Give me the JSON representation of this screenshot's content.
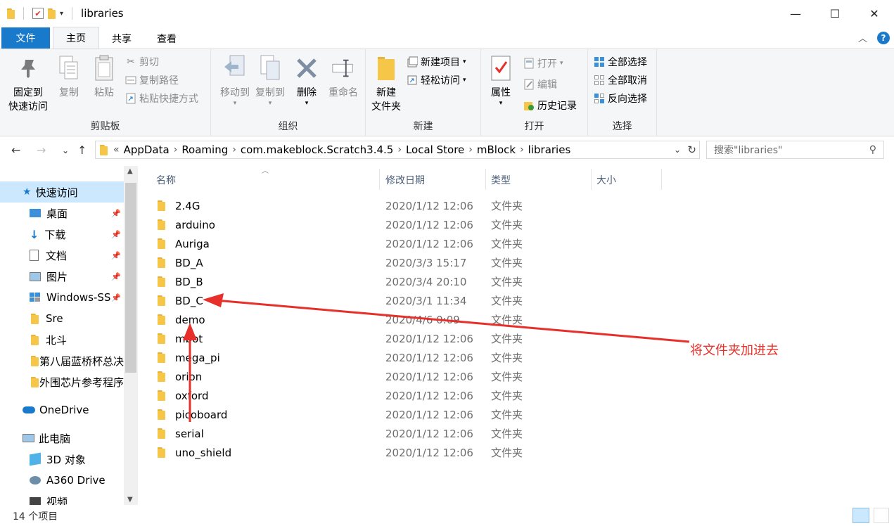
{
  "window": {
    "title": "libraries",
    "controls": {
      "minimize": "—",
      "maximize": "☐",
      "close": "✕"
    }
  },
  "tabs": [
    {
      "label": "文件"
    },
    {
      "label": "主页"
    },
    {
      "label": "共享"
    },
    {
      "label": "查看"
    }
  ],
  "ribbon": {
    "clipboard": {
      "label": "剪贴板",
      "pin_line1": "固定到",
      "pin_line2": "快速访问",
      "copy": "复制",
      "paste": "粘贴",
      "cut": "剪切",
      "copy_path": "复制路径",
      "paste_shortcut": "粘贴快捷方式"
    },
    "organize": {
      "label": "组织",
      "move_to": "移动到",
      "copy_to": "复制到",
      "delete": "删除",
      "rename": "重命名"
    },
    "new": {
      "label": "新建",
      "new_folder_line1": "新建",
      "new_folder_line2": "文件夹",
      "new_item": "新建项目",
      "easy_access": "轻松访问"
    },
    "open": {
      "label": "打开",
      "properties": "属性",
      "open": "打开",
      "edit": "编辑",
      "history": "历史记录"
    },
    "select": {
      "label": "选择",
      "select_all": "全部选择",
      "select_none": "全部取消",
      "invert": "反向选择"
    }
  },
  "address": {
    "prefix": "«",
    "crumbs": [
      "AppData",
      "Roaming",
      "com.makeblock.Scratch3.4.5",
      "Local Store",
      "mBlock",
      "libraries"
    ],
    "search_placeholder": "搜索\"libraries\""
  },
  "sidebar": {
    "quick_access": "快速访问",
    "items": [
      {
        "label": "桌面",
        "pinned": true
      },
      {
        "label": "下载",
        "pinned": true
      },
      {
        "label": "文档",
        "pinned": true
      },
      {
        "label": "图片",
        "pinned": true
      },
      {
        "label": "Windows-SS",
        "pinned": true
      },
      {
        "label": "Sre",
        "pinned": false
      },
      {
        "label": "北斗",
        "pinned": false
      },
      {
        "label": "第八届蓝桥杯总决",
        "pinned": false
      },
      {
        "label": "外围芯片参考程序",
        "pinned": false
      }
    ],
    "onedrive": "OneDrive",
    "this_pc": "此电脑",
    "pc_items": [
      {
        "label": "3D 对象"
      },
      {
        "label": "A360 Drive"
      },
      {
        "label": "视频"
      }
    ]
  },
  "columns": {
    "name": "名称",
    "date": "修改日期",
    "type": "类型",
    "size": "大小"
  },
  "files": [
    {
      "name": "2.4G",
      "date": "2020/1/12 12:06",
      "type": "文件夹"
    },
    {
      "name": "arduino",
      "date": "2020/1/12 12:06",
      "type": "文件夹"
    },
    {
      "name": "Auriga",
      "date": "2020/1/12 12:06",
      "type": "文件夹"
    },
    {
      "name": "BD_A",
      "date": "2020/3/3 15:17",
      "type": "文件夹"
    },
    {
      "name": "BD_B",
      "date": "2020/3/4 20:10",
      "type": "文件夹"
    },
    {
      "name": "BD_C",
      "date": "2020/3/1 11:34",
      "type": "文件夹"
    },
    {
      "name": "demo",
      "date": "2020/4/6 0:09",
      "type": "文件夹"
    },
    {
      "name": "mbot",
      "date": "2020/1/12 12:06",
      "type": "文件夹"
    },
    {
      "name": "mega_pi",
      "date": "2020/1/12 12:06",
      "type": "文件夹"
    },
    {
      "name": "orion",
      "date": "2020/1/12 12:06",
      "type": "文件夹"
    },
    {
      "name": "oxford",
      "date": "2020/1/12 12:06",
      "type": "文件夹"
    },
    {
      "name": "picoboard",
      "date": "2020/1/12 12:06",
      "type": "文件夹"
    },
    {
      "name": "serial",
      "date": "2020/1/12 12:06",
      "type": "文件夹"
    },
    {
      "name": "uno_shield",
      "date": "2020/1/12 12:06",
      "type": "文件夹"
    }
  ],
  "status": {
    "count": "14 个项目"
  },
  "annotation": {
    "text": "将文件夹加进去",
    "color": "#e8302a"
  },
  "colors": {
    "accent": "#1979ca",
    "selection": "#cce8ff",
    "folder": "#f6c649"
  }
}
